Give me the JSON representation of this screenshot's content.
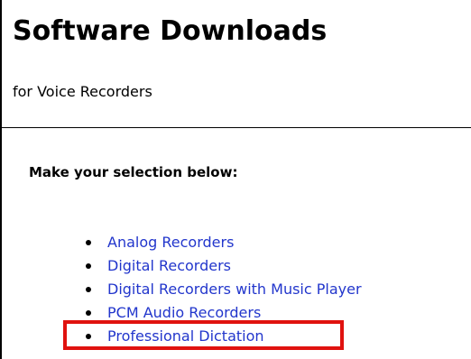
{
  "header": {
    "title": "Software Downloads",
    "subtitle": "for Voice Recorders"
  },
  "main": {
    "prompt": "Make your selection below:",
    "links": [
      {
        "label": "Analog Recorders"
      },
      {
        "label": "Digital Recorders"
      },
      {
        "label": "Digital Recorders with Music Player"
      },
      {
        "label": "PCM Audio Recorders"
      },
      {
        "label": "Professional Dictation"
      }
    ],
    "highlighted_item": "Professional Dictation"
  },
  "colors": {
    "link": "#2236cc",
    "highlight": "#e0120f",
    "text": "#000000",
    "background": "#ffffff"
  }
}
